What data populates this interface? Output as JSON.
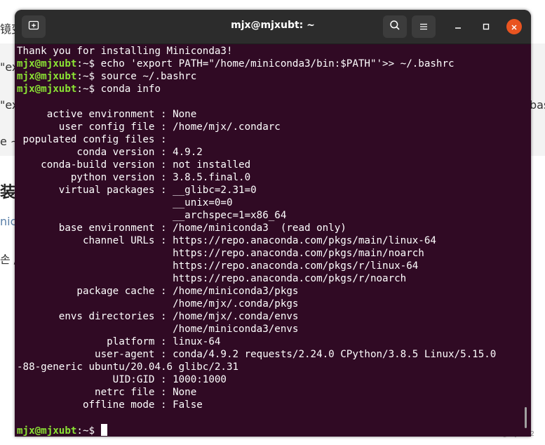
{
  "background": {
    "fragments": [
      "镜变",
      "\"ex",
      "\"ex",
      "e ~",
      "装",
      "nico",
      "손 /"
    ],
    "link_fragment": "nico",
    "right_fragment": "bas",
    "watermark": "CSDN @mjx792"
  },
  "window": {
    "title": "mjx@mjxubt: ~"
  },
  "icons": {
    "new_tab": "new-tab-icon",
    "search": "search-icon",
    "menu": "hamburger-menu-icon",
    "minimize": "minimize-icon",
    "maximize": "maximize-icon",
    "close": "close-icon"
  },
  "colors": {
    "terminal_bg": "#300a24",
    "prompt": "#8ae234",
    "close_button": "#e95420"
  },
  "terminal": {
    "prompt_user": "mjx@mjxubt",
    "lines": [
      {
        "text": "Thank you for installing Miniconda3!"
      },
      {
        "prompt": "mjx@mjxubt",
        "suffix": ":~$ ",
        "text": "echo 'export PATH=\"/home/miniconda3/bin:$PATH\"'>> ~/.bashrc"
      },
      {
        "prompt": "mjx@mjxubt",
        "suffix": ":~$ ",
        "text": "source ~/.bashrc"
      },
      {
        "prompt": "mjx@mjxubt",
        "suffix": ":~$ ",
        "text": "conda info"
      },
      {
        "text": ""
      },
      {
        "text": "     active environment : None"
      },
      {
        "text": "       user config file : /home/mjx/.condarc"
      },
      {
        "text": " populated config files : "
      },
      {
        "text": "          conda version : 4.9.2"
      },
      {
        "text": "    conda-build version : not installed"
      },
      {
        "text": "         python version : 3.8.5.final.0"
      },
      {
        "text": "       virtual packages : __glibc=2.31=0"
      },
      {
        "text": "                          __unix=0=0"
      },
      {
        "text": "                          __archspec=1=x86_64"
      },
      {
        "text": "       base environment : /home/miniconda3  (read only)"
      },
      {
        "text": "           channel URLs : https://repo.anaconda.com/pkgs/main/linux-64"
      },
      {
        "text": "                          https://repo.anaconda.com/pkgs/main/noarch"
      },
      {
        "text": "                          https://repo.anaconda.com/pkgs/r/linux-64"
      },
      {
        "text": "                          https://repo.anaconda.com/pkgs/r/noarch"
      },
      {
        "text": "          package cache : /home/miniconda3/pkgs"
      },
      {
        "text": "                          /home/mjx/.conda/pkgs"
      },
      {
        "text": "       envs directories : /home/mjx/.conda/envs"
      },
      {
        "text": "                          /home/miniconda3/envs"
      },
      {
        "text": "               platform : linux-64"
      },
      {
        "text": "             user-agent : conda/4.9.2 requests/2.24.0 CPython/3.8.5 Linux/5.15.0"
      },
      {
        "text": "-88-generic ubuntu/20.04.6 glibc/2.31"
      },
      {
        "text": "                UID:GID : 1000:1000"
      },
      {
        "text": "             netrc file : None"
      },
      {
        "text": "           offline mode : False"
      },
      {
        "text": ""
      },
      {
        "prompt": "mjx@mjxubt",
        "suffix": ":~$ ",
        "text": "",
        "cursor": true
      }
    ]
  }
}
